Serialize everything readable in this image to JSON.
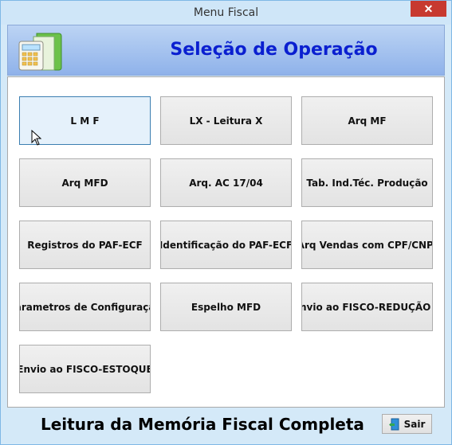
{
  "window": {
    "title": "Menu Fiscal",
    "close_label": "✕"
  },
  "header": {
    "title": "Seleção de Operação",
    "icon": "calculator-folder-icon"
  },
  "operations": [
    {
      "label": "L M F",
      "active": true
    },
    {
      "label": "LX - Leitura X"
    },
    {
      "label": "Arq MF"
    },
    {
      "label": "Arq MFD"
    },
    {
      "label": "Arq. AC 17/04"
    },
    {
      "label": "Tab. Ind.Téc. Produção"
    },
    {
      "label": "Registros do PAF-ECF"
    },
    {
      "label": "Identificação do PAF-ECF"
    },
    {
      "label": "Arq Vendas com CPF/CNPJ"
    },
    {
      "label": "Parametros de Configuração"
    },
    {
      "label": "Espelho MFD"
    },
    {
      "label": "Envio ao FISCO-REDUÇÃO Z"
    },
    {
      "label": "Envio ao FISCO-ESTOQUE"
    }
  ],
  "footer": {
    "description": "Leitura da Memória Fiscal Completa",
    "exit_label": "Sair",
    "exit_icon": "exit-door-icon"
  },
  "colors": {
    "title_blue": "#0a1fd0",
    "header_gradient_top": "#bcd4f4",
    "header_gradient_bottom": "#8fb2ea"
  }
}
